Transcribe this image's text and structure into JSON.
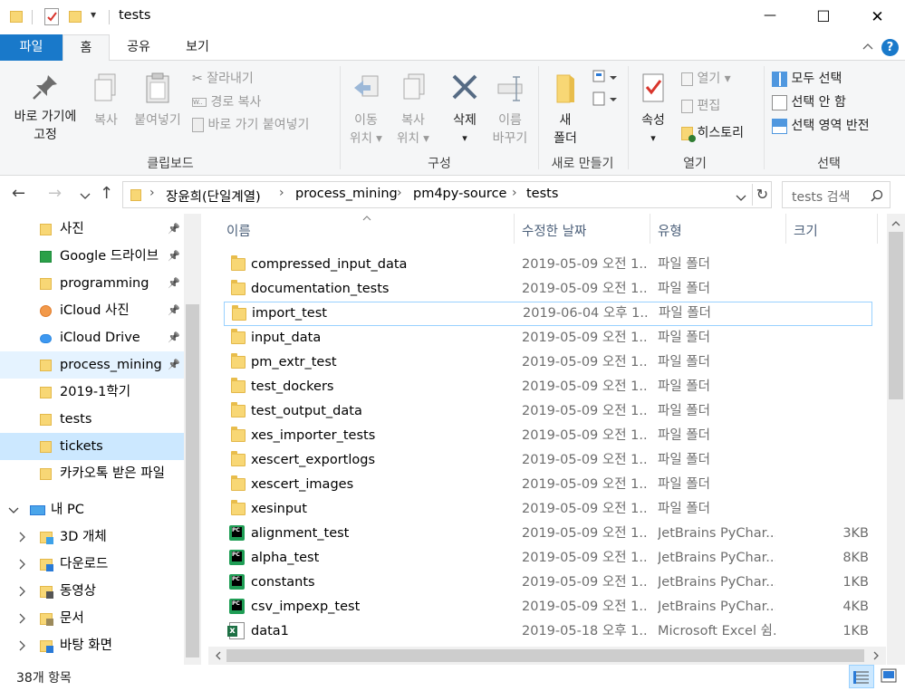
{
  "window": {
    "title": "tests",
    "qat_dropdown": "▾",
    "minimize": "—",
    "maximize": "☐",
    "close": "✕"
  },
  "tabs": {
    "file": "파일",
    "home": "홈",
    "share": "공유",
    "view": "보기",
    "collapse": "^",
    "help": "?"
  },
  "ribbon": {
    "clipboard": {
      "label": "클립보드",
      "pin_line1": "바로 가기에",
      "pin_line2": "고정",
      "copy": "복사",
      "paste": "붙여넣기",
      "cut": "잘라내기",
      "copy_path": "경로 복사",
      "paste_shortcut": "바로 가기 붙여넣기"
    },
    "organize": {
      "label": "구성",
      "move_line1": "이동",
      "move_line2": "위치 ▾",
      "copyto_line1": "복사",
      "copyto_line2": "위치 ▾",
      "delete": "삭제",
      "delete_arrow": "▾",
      "rename_line1": "이름",
      "rename_line2": "바꾸기"
    },
    "new": {
      "label": "새로 만들기",
      "folder_line1": "새",
      "folder_line2": "폴더"
    },
    "open": {
      "label": "열기",
      "properties": "속성",
      "properties_arrow": "▾",
      "open": "열기 ▾",
      "edit": "편집",
      "history": "히스토리"
    },
    "select": {
      "label": "선택",
      "select_all": "모두 선택",
      "select_none": "선택 안 함",
      "invert": "선택 영역 반전"
    }
  },
  "address": {
    "back": "←",
    "forward": "→",
    "recent": "⌄",
    "up": "↑",
    "crumbs": [
      "장윤희(단일계열)",
      "process_mining",
      "pm4py-source",
      "tests"
    ],
    "sep": "›",
    "dropdown": "⌄",
    "refresh": "↻",
    "search_placeholder": "tests 검색"
  },
  "nav": [
    {
      "label": "사진",
      "pinned": true,
      "icon": "folder-icon"
    },
    {
      "label": "Google 드라이브",
      "pinned": true,
      "icon": "google-drive-icon"
    },
    {
      "label": "programming",
      "pinned": true,
      "icon": "folder-icon"
    },
    {
      "label": "iCloud 사진",
      "pinned": true,
      "icon": "icloud-photos-icon"
    },
    {
      "label": "iCloud Drive",
      "pinned": true,
      "icon": "icloud-drive-icon"
    },
    {
      "label": "process_mining",
      "pinned": true,
      "icon": "folder-icon",
      "state": "hover"
    },
    {
      "label": "2019-1학기",
      "pinned": false,
      "icon": "sync-folder-icon"
    },
    {
      "label": "tests",
      "pinned": false,
      "icon": "folder-icon"
    },
    {
      "label": "tickets",
      "pinned": false,
      "icon": "shared-folder-icon",
      "state": "selected"
    },
    {
      "label": "카카오톡 받은 파일",
      "pinned": false,
      "icon": "folder-icon"
    }
  ],
  "nav_pc": {
    "label": "내 PC",
    "children": [
      "3D 개체",
      "다운로드",
      "동영상",
      "문서",
      "바탕 화면"
    ]
  },
  "columns": {
    "name": "이름",
    "date": "수정한 날짜",
    "type": "유형",
    "size": "크기"
  },
  "files": [
    {
      "name": "compressed_input_data",
      "date": "2019-05-09 오전 1...",
      "type": "파일 폴더",
      "size": "",
      "kind": "folder"
    },
    {
      "name": "documentation_tests",
      "date": "2019-05-09 오전 1...",
      "type": "파일 폴더",
      "size": "",
      "kind": "folder"
    },
    {
      "name": "import_test",
      "date": "2019-06-04 오후 1...",
      "type": "파일 폴더",
      "size": "",
      "kind": "folder",
      "focus": true
    },
    {
      "name": "input_data",
      "date": "2019-05-09 오전 1...",
      "type": "파일 폴더",
      "size": "",
      "kind": "folder"
    },
    {
      "name": "pm_extr_test",
      "date": "2019-05-09 오전 1...",
      "type": "파일 폴더",
      "size": "",
      "kind": "folder"
    },
    {
      "name": "test_dockers",
      "date": "2019-05-09 오전 1...",
      "type": "파일 폴더",
      "size": "",
      "kind": "folder"
    },
    {
      "name": "test_output_data",
      "date": "2019-05-09 오전 1...",
      "type": "파일 폴더",
      "size": "",
      "kind": "folder"
    },
    {
      "name": "xes_importer_tests",
      "date": "2019-05-09 오전 1...",
      "type": "파일 폴더",
      "size": "",
      "kind": "folder"
    },
    {
      "name": "xescert_exportlogs",
      "date": "2019-05-09 오전 1...",
      "type": "파일 폴더",
      "size": "",
      "kind": "folder"
    },
    {
      "name": "xescert_images",
      "date": "2019-05-09 오전 1...",
      "type": "파일 폴더",
      "size": "",
      "kind": "folder"
    },
    {
      "name": "xesinput",
      "date": "2019-05-09 오전 1...",
      "type": "파일 폴더",
      "size": "",
      "kind": "folder"
    },
    {
      "name": "alignment_test",
      "date": "2019-05-09 오전 1...",
      "type": "JetBrains PyChar...",
      "size": "3KB",
      "kind": "py"
    },
    {
      "name": "alpha_test",
      "date": "2019-05-09 오전 1...",
      "type": "JetBrains PyChar...",
      "size": "8KB",
      "kind": "py"
    },
    {
      "name": "constants",
      "date": "2019-05-09 오전 1...",
      "type": "JetBrains PyChar...",
      "size": "1KB",
      "kind": "py"
    },
    {
      "name": "csv_impexp_test",
      "date": "2019-05-09 오전 1...",
      "type": "JetBrains PyChar...",
      "size": "4KB",
      "kind": "py"
    },
    {
      "name": "data1",
      "date": "2019-05-18 오후 1...",
      "type": "Microsoft Excel 쉼...",
      "size": "1KB",
      "kind": "xl"
    }
  ],
  "status": {
    "count": "38개 항목"
  }
}
